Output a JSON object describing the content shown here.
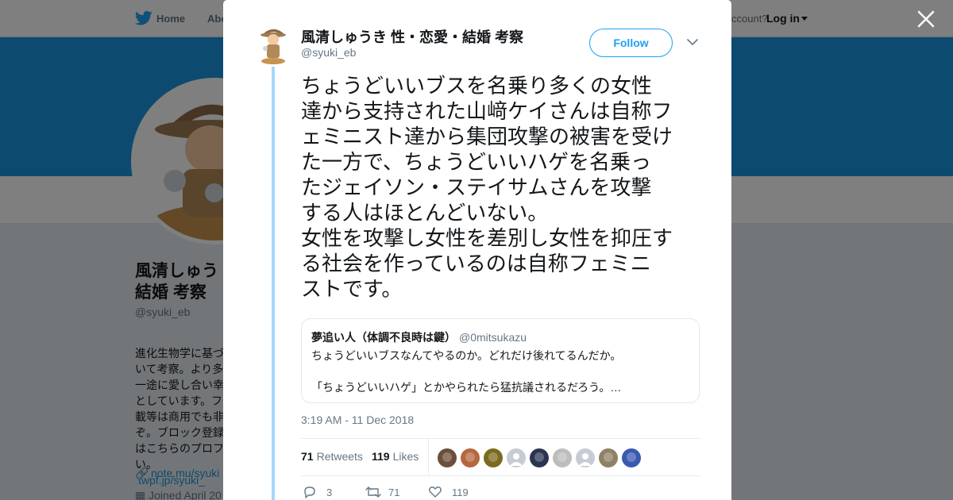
{
  "background": {
    "nav": {
      "home": "Home",
      "about": "Abo",
      "account_prompt": "ccount?",
      "login": "Log in"
    },
    "profile": {
      "name": "風清しゅう\n結婚 考察",
      "handle": "@syuki_eb",
      "bio": "進化生物学に基づ\nいて考察。より多\n一途に愛し合い幸\nとしています。フ\n載等は商用でも非\nぞ。ブロック登録\nはこちらのプロフ\nい。",
      "bio_link": "twpf.jp/syuki_",
      "url": "note.mu/syuki",
      "joined": "Joined April 20"
    }
  },
  "modal": {
    "author_name": "風清しゅうき 性・恋愛・結婚 考察",
    "author_handle": "@syuki_eb",
    "follow_label": "Follow",
    "tweet_text": "ちょうどいいブスを名乗り多くの女性\n達から支持された山﨑ケイさんは自称フ\nェミニスト達から集団攻撃の被害を受け\nた一方で、ちょうどいいハゲを名乗っ\nたジェイソン・ステイサムさんを攻撃\nする人はほとんどいない。\n女性を攻撃し女性を差別し女性を抑圧す\nる社会を作っているのは自称フェミニ\nストです。",
    "quote": {
      "name": "夢追い人（体調不良時は鍵）",
      "handle": "@0mitsukazu",
      "text": "ちょうどいいブスなんてやるのか。どれだけ後れてるんだか。\n\n「ちょうどいいハゲ」とかやられたら猛抗議されるだろう。…"
    },
    "timestamp": "3:19 AM - 11 Dec 2018",
    "stats": {
      "retweets_count": "71",
      "retweets_label": "Retweets",
      "likes_count": "119",
      "likes_label": "Likes"
    },
    "likers": [
      {
        "icon": "liker-avatar-1",
        "color": "#6b4f3a"
      },
      {
        "icon": "liker-avatar-2",
        "color": "#b5673f"
      },
      {
        "icon": "liker-avatar-3",
        "color": "#7a6a1d"
      },
      {
        "icon": "liker-avatar-default",
        "color": "#c5ccd3"
      },
      {
        "icon": "liker-avatar-4",
        "color": "#2a3550"
      },
      {
        "icon": "liker-avatar-5",
        "color": "#bdbdbd"
      },
      {
        "icon": "liker-avatar-default",
        "color": "#c5ccd3"
      },
      {
        "icon": "liker-avatar-6",
        "color": "#8f8066"
      },
      {
        "icon": "liker-avatar-7",
        "color": "#3a59b0"
      }
    ],
    "actions": {
      "replies": "3",
      "retweets": "71",
      "likes": "119"
    }
  },
  "colors": {
    "accent": "#1da1f2",
    "banner": "#1b95e0",
    "thread_line": "#a5d6f9"
  }
}
